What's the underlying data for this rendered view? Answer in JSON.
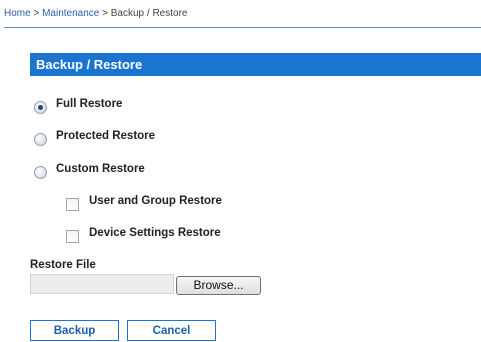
{
  "breadcrumb": {
    "home": "Home",
    "maintenance": "Maintenance",
    "current": "Backup / Restore",
    "separator": ">"
  },
  "panel": {
    "title": "Backup / Restore"
  },
  "restore_options": [
    {
      "label": "Full Restore",
      "checked": true
    },
    {
      "label": "Protected Restore",
      "checked": false
    },
    {
      "label": "Custom Restore",
      "checked": false
    }
  ],
  "custom_options": [
    {
      "label": "User and Group Restore",
      "checked": false
    },
    {
      "label": "Device Settings Restore",
      "checked": false
    }
  ],
  "restore_file": {
    "label": "Restore File",
    "value": "",
    "browse_label": "Browse..."
  },
  "actions": {
    "backup_label": "Backup",
    "cancel_label": "Cancel"
  },
  "colors": {
    "accent": "#1a74d0",
    "link": "#2a5db0"
  }
}
